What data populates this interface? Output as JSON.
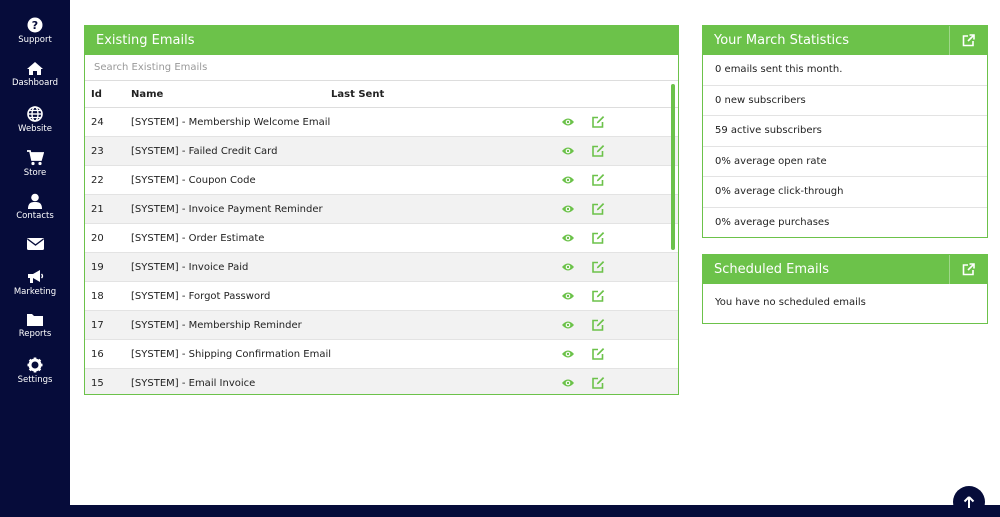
{
  "sidebar": {
    "items": [
      {
        "label": "Support",
        "icon": "question-circle-icon"
      },
      {
        "label": "Dashboard",
        "icon": "home-icon"
      },
      {
        "label": "Website",
        "icon": "globe-icon"
      },
      {
        "label": "Store",
        "icon": "cart-icon"
      },
      {
        "label": "Contacts",
        "icon": "user-icon"
      },
      {
        "label": "",
        "icon": "envelope-icon"
      },
      {
        "label": "Marketing",
        "icon": "megaphone-icon"
      },
      {
        "label": "Reports",
        "icon": "folder-icon"
      },
      {
        "label": "Settings",
        "icon": "gear-icon"
      }
    ]
  },
  "emails": {
    "title": "Existing Emails",
    "search_placeholder": "Search Existing Emails",
    "columns": {
      "id": "Id",
      "name": "Name",
      "last_sent": "Last Sent"
    },
    "rows": [
      {
        "id": "24",
        "name": "[SYSTEM] - Membership Welcome Email",
        "last_sent": ""
      },
      {
        "id": "23",
        "name": "[SYSTEM] - Failed Credit Card",
        "last_sent": ""
      },
      {
        "id": "22",
        "name": "[SYSTEM] - Coupon Code",
        "last_sent": ""
      },
      {
        "id": "21",
        "name": "[SYSTEM] - Invoice Payment Reminder",
        "last_sent": ""
      },
      {
        "id": "20",
        "name": "[SYSTEM] - Order Estimate",
        "last_sent": ""
      },
      {
        "id": "19",
        "name": "[SYSTEM] - Invoice Paid",
        "last_sent": ""
      },
      {
        "id": "18",
        "name": "[SYSTEM] - Forgot Password",
        "last_sent": ""
      },
      {
        "id": "17",
        "name": "[SYSTEM] - Membership Reminder",
        "last_sent": ""
      },
      {
        "id": "16",
        "name": "[SYSTEM] - Shipping Confirmation Email",
        "last_sent": ""
      },
      {
        "id": "15",
        "name": "[SYSTEM] - Email Invoice",
        "last_sent": ""
      }
    ]
  },
  "stats": {
    "title": "Your March Statistics",
    "rows": [
      "0 emails sent this month.",
      "0 new subscribers",
      "59 active subscribers",
      "0% average open rate",
      "0% average click-through",
      "0% average purchases"
    ]
  },
  "scheduled": {
    "title": "Scheduled Emails",
    "message": "You have no scheduled emails"
  },
  "colors": {
    "sidebar_bg": "#060c3a",
    "accent_green": "#6cc24a"
  }
}
